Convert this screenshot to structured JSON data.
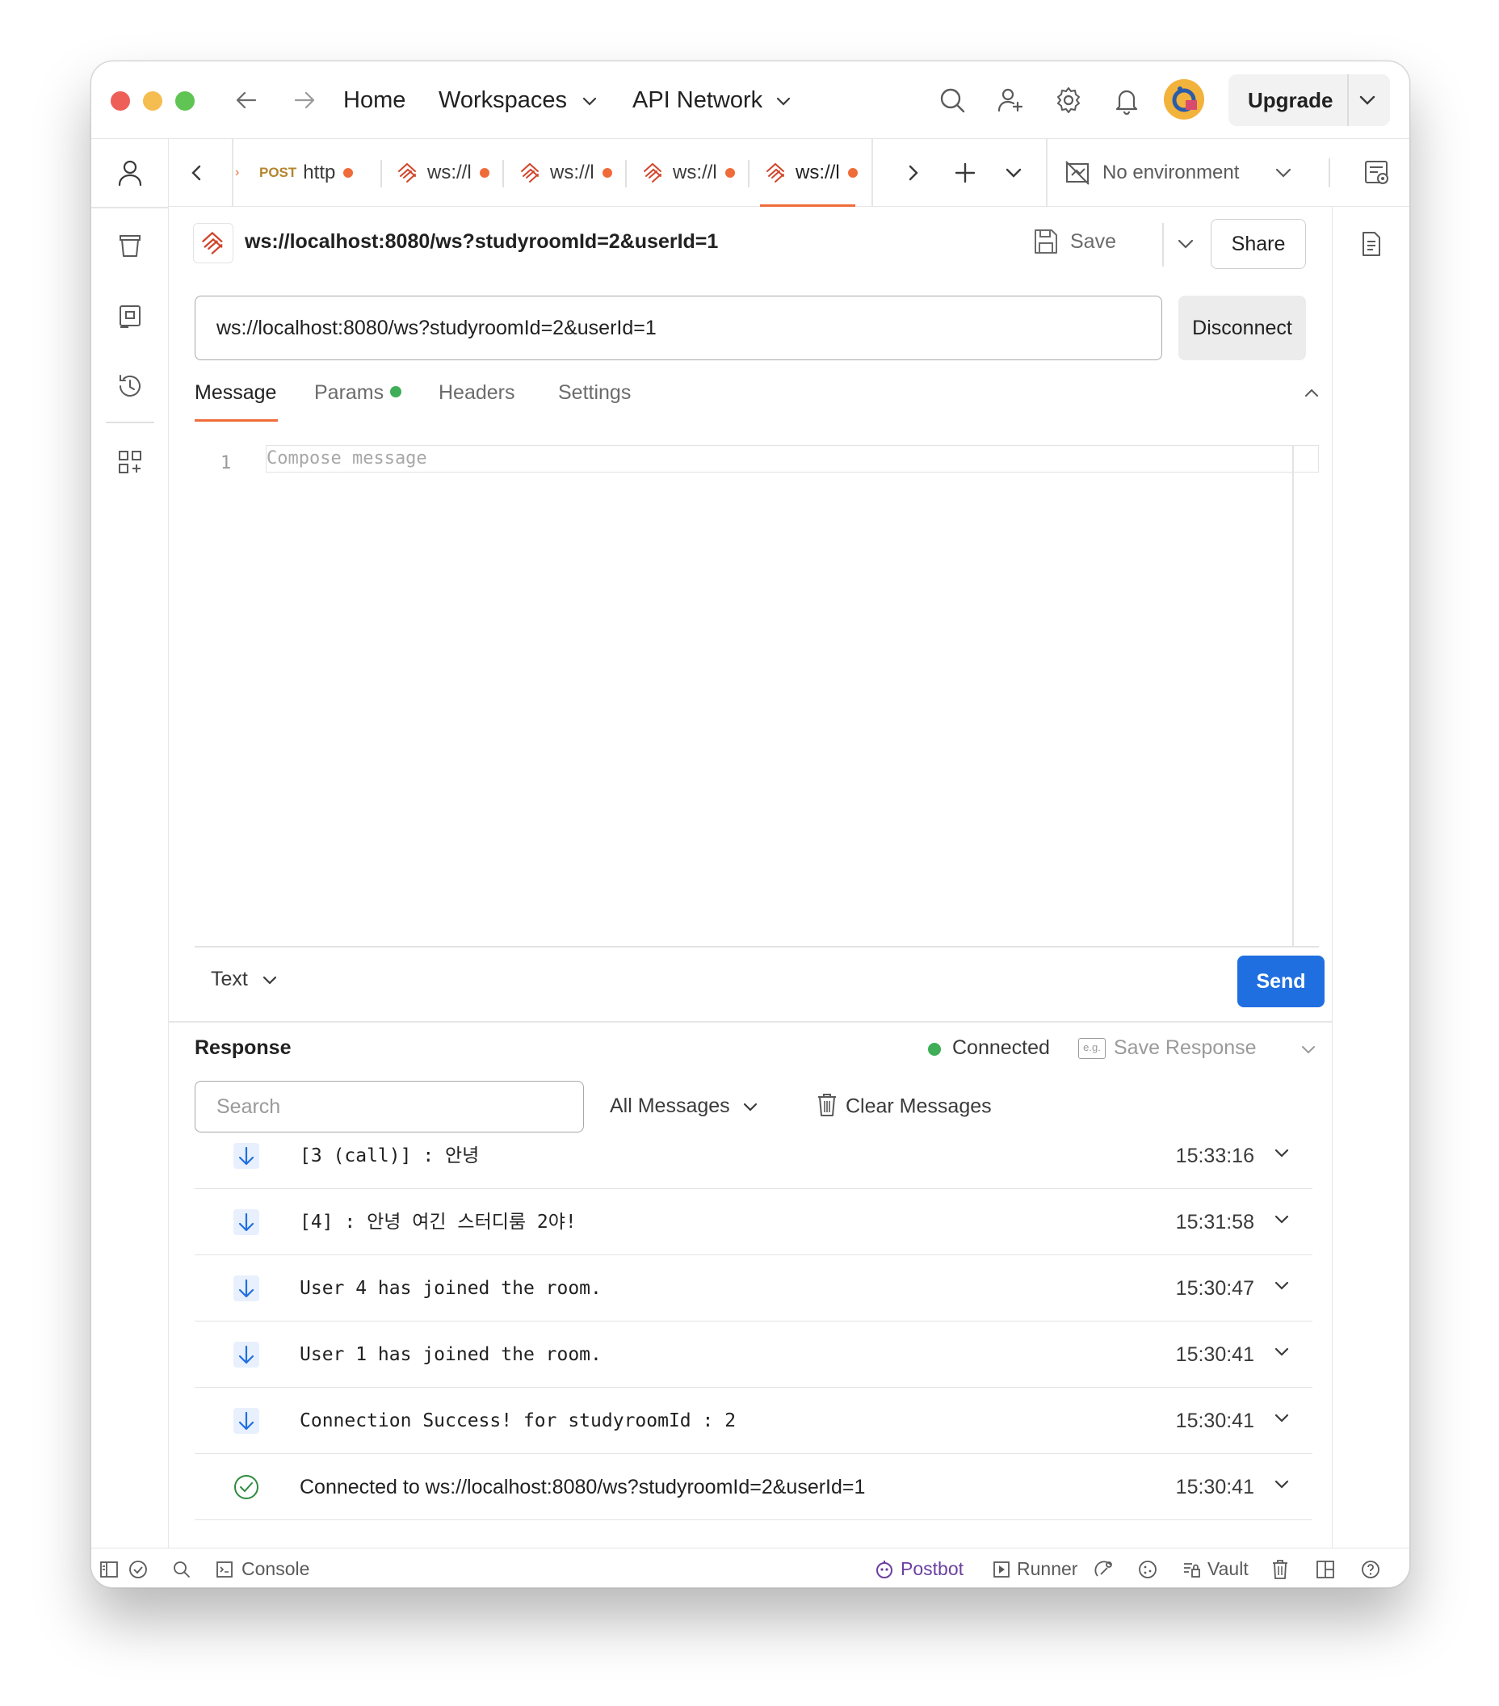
{
  "titlebar": {
    "home": "Home",
    "workspaces": "Workspaces",
    "api_network": "API Network",
    "upgrade": "Upgrade"
  },
  "tabs": {
    "post_method": "POST",
    "post_label": "http",
    "ws_label": "ws://l",
    "environment": "No environment"
  },
  "request": {
    "title": "ws://localhost:8080/ws?studyroomId=2&userId=1",
    "save": "Save",
    "share": "Share",
    "url": "ws://localhost:8080/ws?studyroomId=2&userId=1",
    "disconnect": "Disconnect",
    "sub_tabs": [
      "Message",
      "Params",
      "Headers",
      "Settings"
    ]
  },
  "editor": {
    "line_number": "1",
    "placeholder": "Compose message",
    "format": "Text",
    "send": "Send"
  },
  "response": {
    "title": "Response",
    "status": "Connected",
    "save_response": "Save Response",
    "search_placeholder": "Search",
    "filter": "All Messages",
    "clear": "Clear Messages",
    "messages": [
      {
        "text": "[3 (call)] : 안녕",
        "time": "15:33:16",
        "kind": "incoming"
      },
      {
        "text": "[4] : 안녕 여긴 스터디룸 2야!",
        "time": "15:31:58",
        "kind": "incoming"
      },
      {
        "text": "User 4 has joined the room.",
        "time": "15:30:47",
        "kind": "incoming"
      },
      {
        "text": "User 1 has joined the room.",
        "time": "15:30:41",
        "kind": "incoming"
      },
      {
        "text": "Connection Success! for studyroomId : 2",
        "time": "15:30:41",
        "kind": "incoming"
      },
      {
        "text": "Connected to ws://localhost:8080/ws?studyroomId=2&userId=1",
        "time": "15:30:41",
        "kind": "connected"
      }
    ]
  },
  "footer": {
    "console": "Console",
    "postbot": "Postbot",
    "runner": "Runner",
    "vault": "Vault"
  },
  "colors": {
    "accent": "#ef6c3a",
    "send": "#1f6fe0",
    "connected": "#3fae56",
    "postbot": "#6b3fa0"
  }
}
